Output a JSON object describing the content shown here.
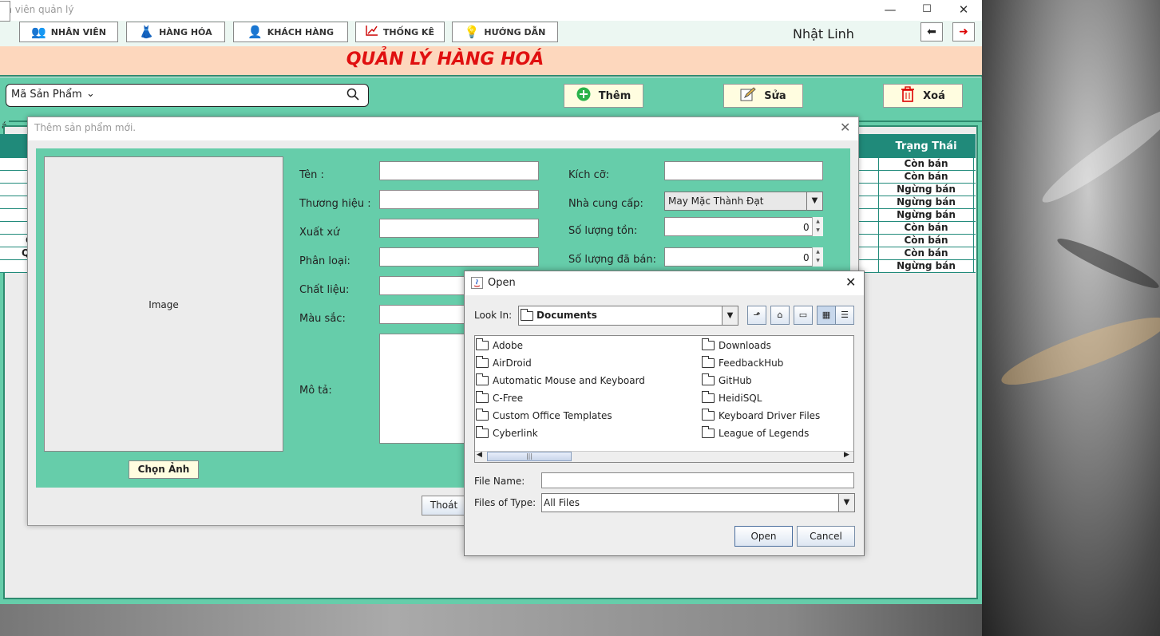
{
  "window": {
    "title": "ản viên quản lý",
    "minimize": "—",
    "maximize": "☐",
    "close": "✕"
  },
  "nav": {
    "items": [
      {
        "label": "NHÂN VIÊN",
        "icon": "staff-icon"
      },
      {
        "label": "HÀNG HÓA",
        "icon": "goods-icon"
      },
      {
        "label": "KHÁCH HÀNG",
        "icon": "customer-icon"
      },
      {
        "label": "THỐNG KÊ",
        "icon": "statistics-icon"
      },
      {
        "label": "HƯỚNG DẪN",
        "icon": "help-bulb-icon"
      }
    ],
    "user_name": "Nhật Linh"
  },
  "page": {
    "title": "QUẢN LÝ HÀNG HOÁ"
  },
  "toolbar": {
    "search_field": "Mã Sản Phẩm",
    "add_label": "Thêm",
    "edit_label": "Sửa",
    "delete_label": "Xoá"
  },
  "table": {
    "fragment_a": "á",
    "status_header": "Trạng Thái",
    "rows": [
      "Còn bán",
      "Còn bán",
      "Ngừng bán",
      "Ngừng bán",
      "Ngừng bán",
      "Còn bán",
      "Còn bán",
      "Còn bán",
      "Ngừng bán"
    ],
    "row_fragments": [
      "C",
      "Q"
    ]
  },
  "add_dialog": {
    "title": "Thêm sản phẩm mới.",
    "image_label": "Image",
    "choose_image_label": "Chọn Ảnh",
    "labels": {
      "name": "Tên :",
      "brand": "Thương hiệu :",
      "origin": "Xuất xứ",
      "category": "Phân loại:",
      "material": "Chất liệu:",
      "color": "Màu sắc:",
      "description": "Mô tả:",
      "size": "Kích cỡ:",
      "supplier": "Nhà cung cấp:",
      "stock": "Số lượng tồn:",
      "sold": "Số lượng đã bán:"
    },
    "supplier_value": "May Mặc Thành Đạt",
    "stock_value": "0",
    "sold_value": "0",
    "exit_label": "Thoát"
  },
  "open_dialog": {
    "title": "Open",
    "look_in_label": "Look In:",
    "look_in_value": "Documents",
    "left_files": [
      "Adobe",
      "AirDroid",
      "Automatic Mouse and Keyboard",
      "C-Free",
      "Custom Office Templates",
      "Cyberlink"
    ],
    "right_files": [
      "Downloads",
      "FeedbackHub",
      "GitHub",
      "HeidiSQL",
      "Keyboard Driver Files",
      "League of Legends"
    ],
    "file_name_label": "File Name:",
    "file_name_value": "",
    "files_of_type_label": "Files of Type:",
    "files_of_type_value": "All Files",
    "open_label": "Open",
    "cancel_label": "Cancel"
  }
}
